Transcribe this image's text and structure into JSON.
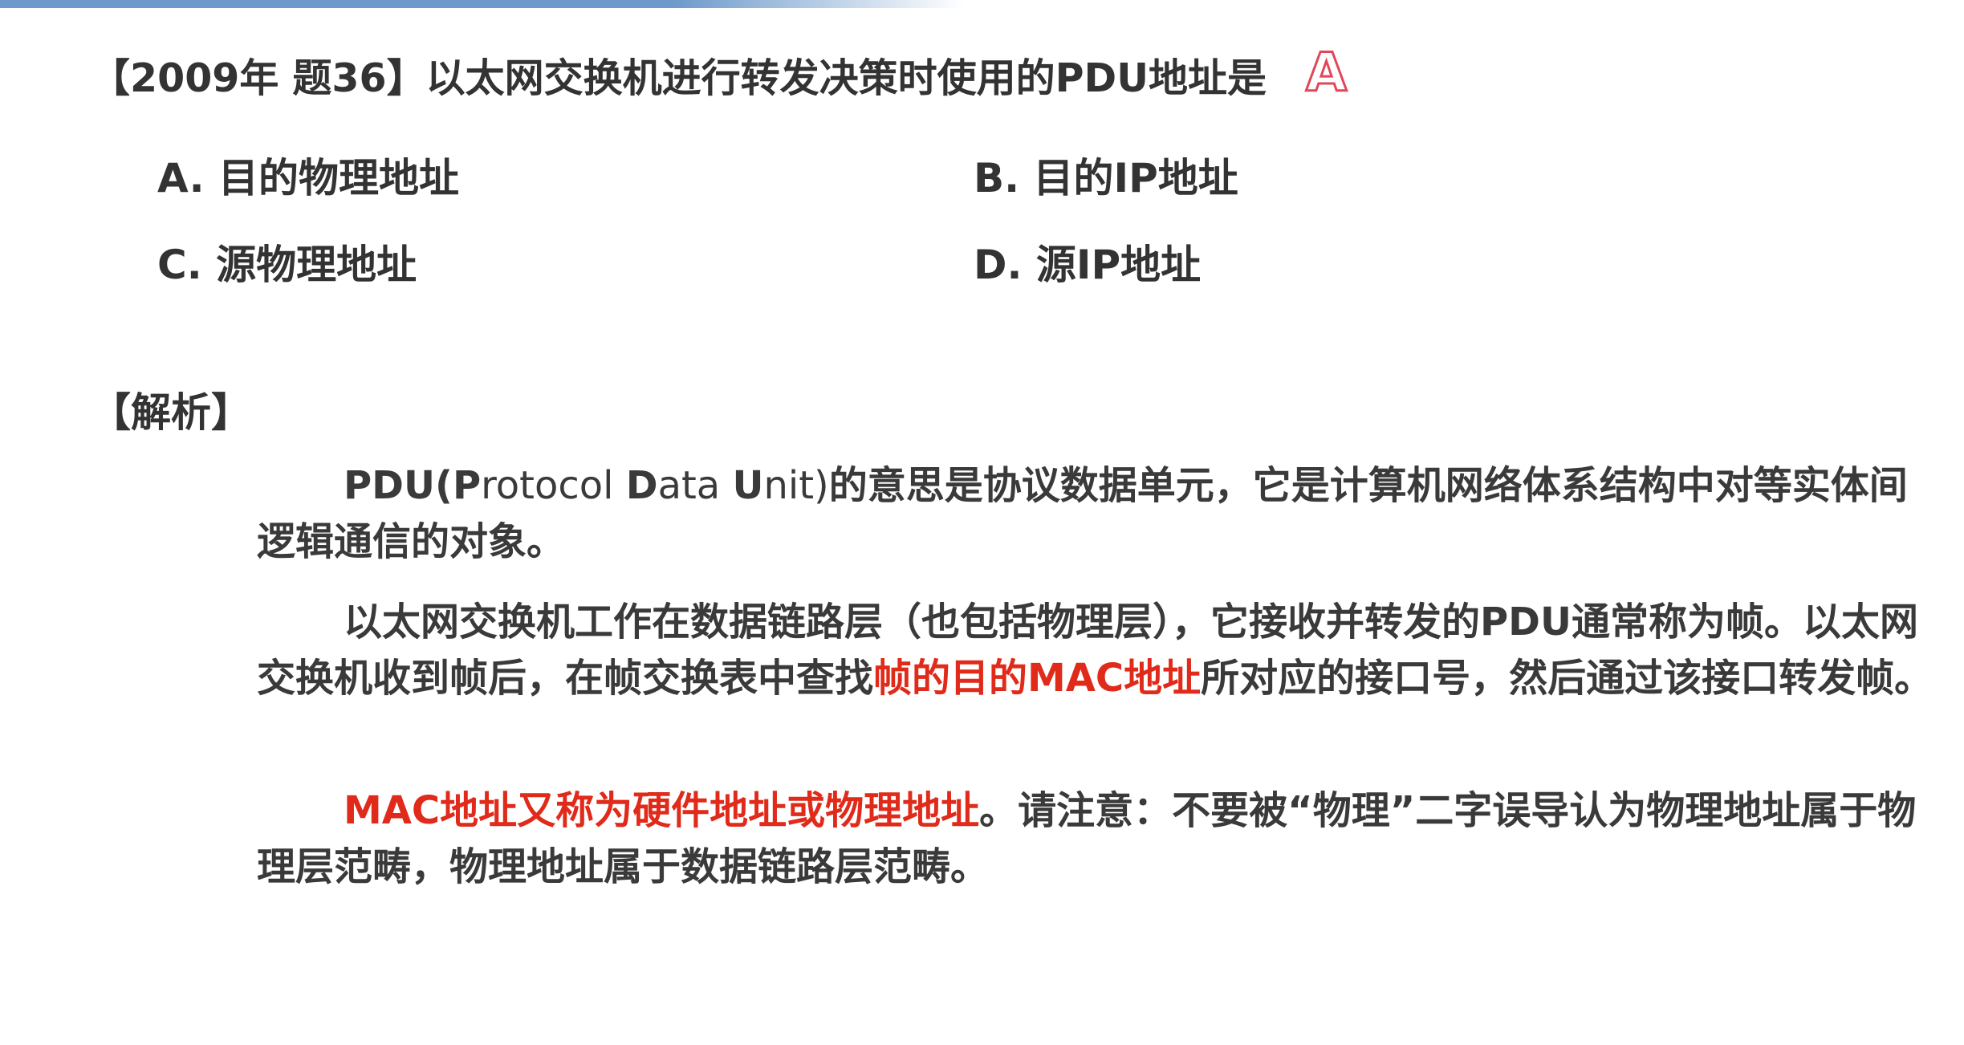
{
  "question": {
    "text": "【2009年 题36】以太网交换机进行转发决策时使用的PDU地址是",
    "answer": "A"
  },
  "options": [
    {
      "label": "A. 目的物理地址"
    },
    {
      "label": "B. 目的IP地址"
    },
    {
      "label": "C. 源物理地址"
    },
    {
      "label": "D. 源IP地址"
    }
  ],
  "analysis": {
    "title": "【解析】",
    "p1": {
      "pdu": "PDU(",
      "p": "P",
      "rotocol": "rotocol ",
      "d": "D",
      "ata": "ata ",
      "u": "U",
      "nit": "nit)",
      "rest": "的意思是协议数据单元，它是计算机网络体系结构中对等实体间逻辑通信的对象。"
    },
    "p2": {
      "before": "以太网交换机工作在数据链路层（也包括物理层），它接收并转发的PDU通常称为帧。以太网交换机收到帧后，在帧交换表中查找",
      "highlight": "帧的目的MAC地址",
      "after": "所对应的接口号，然后通过该接口转发帧。"
    },
    "p3": {
      "highlight": "MAC地址又称为硬件地址或物理地址",
      "after": "。请注意：不要被“物理”二字误导认为物理地址属于物理层范畴，物理地址属于数据链路层范畴。"
    }
  },
  "colors": {
    "text": "#333333",
    "highlight": "#e02a1a",
    "answer_outline": "#e0475a"
  }
}
